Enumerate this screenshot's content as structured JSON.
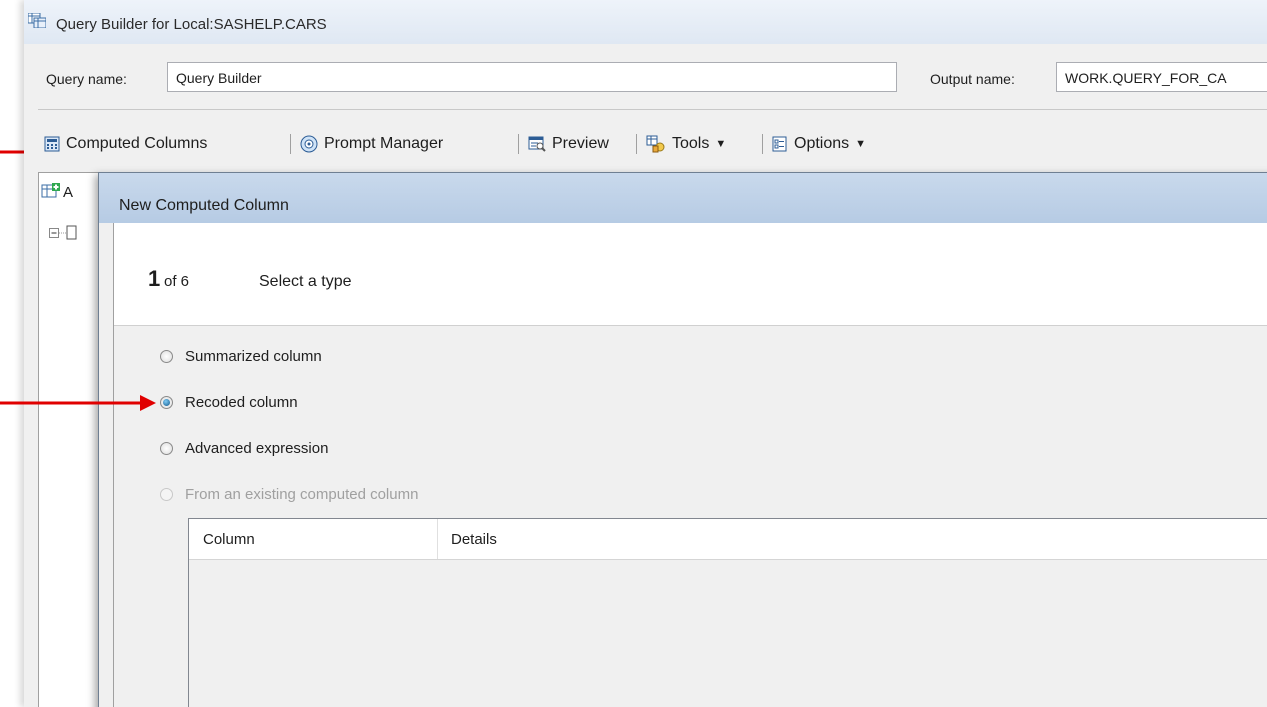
{
  "window": {
    "title": "Query Builder for Local:SASHELP.CARS",
    "query_name_label": "Query name:",
    "query_name_value": "Query Builder",
    "output_name_label": "Output name:",
    "output_name_value": "WORK.QUERY_FOR_CA"
  },
  "toolbar": {
    "computed_columns": "Computed Columns",
    "prompt_manager": "Prompt Manager",
    "preview": "Preview",
    "tools": "Tools",
    "options": "Options"
  },
  "side_panel": {
    "tab_letter": "A"
  },
  "dialog": {
    "title": "New Computed Column",
    "step_number": "1",
    "step_of": "of 6",
    "step_title": "Select a type",
    "options": [
      {
        "label": "Summarized column",
        "selected": false,
        "enabled": true
      },
      {
        "label": "Recoded column",
        "selected": true,
        "enabled": true
      },
      {
        "label": "Advanced expression",
        "selected": false,
        "enabled": true
      },
      {
        "label": "From an existing computed column",
        "selected": false,
        "enabled": false
      }
    ],
    "grid": {
      "columns": [
        "Column",
        "Details"
      ]
    }
  },
  "colors": {
    "annotation_arrow": "#e00000",
    "dialog_title_bg": "#b6cbe4",
    "selected_radio": "#11578a"
  }
}
